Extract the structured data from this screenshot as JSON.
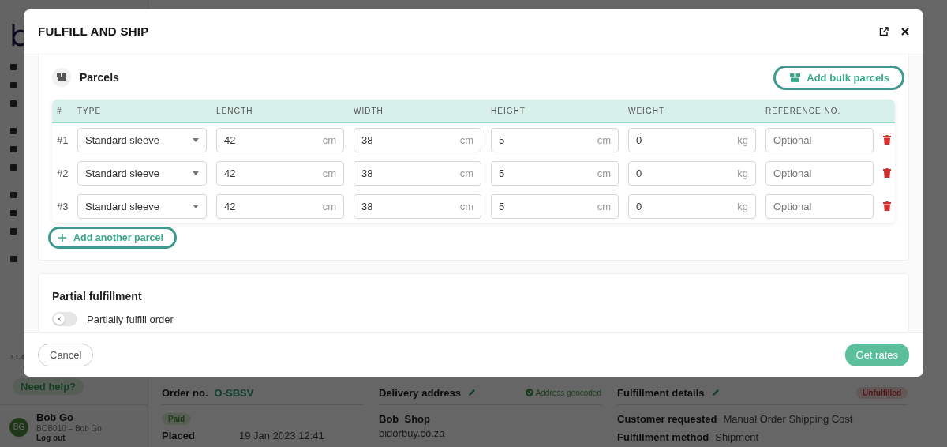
{
  "sidebar": {
    "version": "3.1.4",
    "help": "Need help?",
    "user": {
      "initials": "BG",
      "name": "Bob Go",
      "account": "BOB010 – Bob Go",
      "logout": "Log out"
    }
  },
  "order": {
    "label": "Order no.",
    "number": "O-SBSV",
    "payment": "Paid",
    "placed_label": "Placed",
    "placed": "19 Jan 2023 12:41"
  },
  "delivery": {
    "title": "Delivery address",
    "geocode": "Address geocoded",
    "name": "Bob  Shop",
    "line": "bidorbuy.co.za"
  },
  "fulfillment": {
    "title": "Fulfillment details",
    "status": "Unfulfilled",
    "rows": [
      {
        "label": "Customer requested",
        "value": "Manual Order Shipping Cost"
      },
      {
        "label": "Fulfillment method",
        "value": "Shipment"
      }
    ]
  },
  "modal": {
    "title": "FULFILL AND SHIP",
    "parcels": {
      "title": "Parcels",
      "bulk_button": "Add bulk parcels",
      "columns": [
        "#",
        "TYPE",
        "LENGTH",
        "WIDTH",
        "HEIGHT",
        "WEIGHT",
        "REFERENCE NO."
      ],
      "rows": [
        {
          "number": "#1",
          "type": "Standard sleeve",
          "measures": [
            {
              "value": "42",
              "unit": "cm"
            },
            {
              "value": "38",
              "unit": "cm"
            },
            {
              "value": "5",
              "unit": "cm"
            },
            {
              "value": "0",
              "unit": "kg"
            }
          ],
          "reference_placeholder": "Optional"
        },
        {
          "number": "#2",
          "type": "Standard sleeve",
          "measures": [
            {
              "value": "42",
              "unit": "cm"
            },
            {
              "value": "38",
              "unit": "cm"
            },
            {
              "value": "5",
              "unit": "cm"
            },
            {
              "value": "0",
              "unit": "kg"
            }
          ],
          "reference_placeholder": "Optional"
        },
        {
          "number": "#3",
          "type": "Standard sleeve",
          "measures": [
            {
              "value": "42",
              "unit": "cm"
            },
            {
              "value": "38",
              "unit": "cm"
            },
            {
              "value": "5",
              "unit": "cm"
            },
            {
              "value": "0",
              "unit": "kg"
            }
          ],
          "reference_placeholder": "Optional"
        }
      ],
      "add_button": "Add another parcel"
    },
    "partial": {
      "title": "Partial fulfillment",
      "toggle_label": "Partially fulfill order",
      "on": false
    },
    "cancel": "Cancel",
    "submit": "Get rates"
  }
}
